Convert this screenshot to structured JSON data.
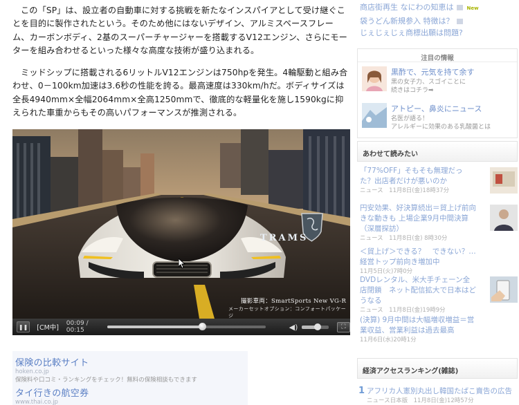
{
  "article": {
    "para1": "この「SP」は、設立者の自動車に対する挑戦を新たなインスパイアとして受け継ぐことを目的に製作されたという。そのため他にはないデザイン、アルミスペースフレーム、カーボンボディ、2基のスーパーチャージャーを搭載するV12エンジン、さらにモーターを組み合わせるといった様々な高度な技術が盛り込まれる。",
    "para2": "ミッドシップに搭載される6リットルV12エンジンは750hpを発生。4輪駆動と組み合わせ、0－100km加速は3.6秒の性能を誇る。最高速度は330km/hだ。ボディサイズは全長4940mm×全幅2064mm×全高1250mmで、徹底的な軽量化を施し1590kgに抑えられた車重からもその高いパフォーマンスが推測される。"
  },
  "video": {
    "brand": "TRAMS",
    "credit_line1": "撮影車両：SmartSports New VG-R",
    "credit_line2": "メーカーセットオプション：コンフォートパッケージ",
    "cm_label": "[CM中]",
    "time": "00:09 / 00:15",
    "progress": 0.6,
    "volume": 0.6
  },
  "ads": {
    "ad1_title": "保険の比較サイト",
    "ad1_url": "hoken.co.jp",
    "ad1_desc": "保険料や口コミ・ランキングをチェック！無料の保険相談もできます",
    "ad2_title": "タイ行きの航空券",
    "ad2_url": "www.thai.co.jp"
  },
  "right": {
    "top_links": [
      "商店街再生 なにわの知恵は",
      "袋うどん新規参入 特徴は？",
      "じぇじぇじぇ商標出願は問題?"
    ],
    "new_badge": "New",
    "notice_header": "注目の情報",
    "notice1_title": "黒酢で、元気を持て余す",
    "notice1_sub1": "黒の女子力、スゴイことに",
    "notice1_sub2": "続きはコチラ➡",
    "notice2_title": "アトピー、鼻炎にニュース",
    "notice2_sub1": "名医が語る！",
    "notice2_sub2": "アレルギーに効果のある乳酸菌とは",
    "related_header": "あわせて読みたい",
    "related": [
      {
        "title": "「77%OFF」そもそも無理だった？出店者だけが悪いのか",
        "meta": "ニュース　11月8日(金)18時37分"
      },
      {
        "title": "円安効果、好決算続出＝貿上げ前向きな動きも 上場企業9月中間決算（深層探訪）",
        "meta": "ニュース　11月8日(金) 8時30分"
      },
      {
        "title": "＜貿上げ＞できる？　できない？…経営トップ前向き増加中",
        "meta": "11月5日(火)7時0分"
      },
      {
        "title": "DVDレンタル、米大手チェーン全店閉鎖　ネット配信拡大で日本はどうなる",
        "meta": "ニュース　11月8日(金)19時9分"
      },
      {
        "title": "(決算) 9月中間は大幅増収増益＝営業収益、営業利益は過去最高",
        "meta": "11月6日(水)20時1分"
      }
    ],
    "ranking_header": "経済アクセスランキング(雑誌)",
    "rank_num": "1",
    "rank_title": "アフリカ人憲別丸出し韓国たばこ賣告の広告",
    "rank_meta": "ニュース日本版　11月8日(金)12時57分"
  }
}
